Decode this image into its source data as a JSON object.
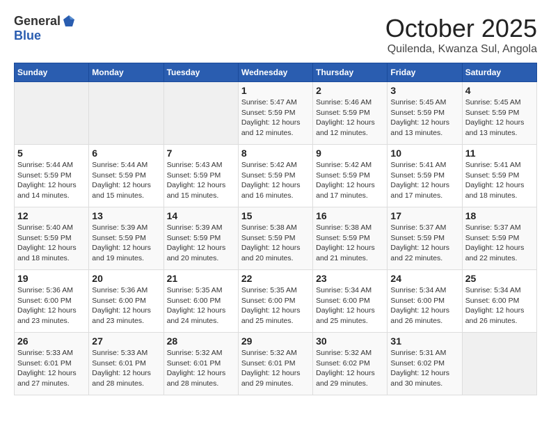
{
  "header": {
    "logo_general": "General",
    "logo_blue": "Blue",
    "month_title": "October 2025",
    "subtitle": "Quilenda, Kwanza Sul, Angola"
  },
  "days_of_week": [
    "Sunday",
    "Monday",
    "Tuesday",
    "Wednesday",
    "Thursday",
    "Friday",
    "Saturday"
  ],
  "weeks": [
    [
      {
        "day": "",
        "content": ""
      },
      {
        "day": "",
        "content": ""
      },
      {
        "day": "",
        "content": ""
      },
      {
        "day": "1",
        "content": "Sunrise: 5:47 AM\nSunset: 5:59 PM\nDaylight: 12 hours\nand 12 minutes."
      },
      {
        "day": "2",
        "content": "Sunrise: 5:46 AM\nSunset: 5:59 PM\nDaylight: 12 hours\nand 12 minutes."
      },
      {
        "day": "3",
        "content": "Sunrise: 5:45 AM\nSunset: 5:59 PM\nDaylight: 12 hours\nand 13 minutes."
      },
      {
        "day": "4",
        "content": "Sunrise: 5:45 AM\nSunset: 5:59 PM\nDaylight: 12 hours\nand 13 minutes."
      }
    ],
    [
      {
        "day": "5",
        "content": "Sunrise: 5:44 AM\nSunset: 5:59 PM\nDaylight: 12 hours\nand 14 minutes."
      },
      {
        "day": "6",
        "content": "Sunrise: 5:44 AM\nSunset: 5:59 PM\nDaylight: 12 hours\nand 15 minutes."
      },
      {
        "day": "7",
        "content": "Sunrise: 5:43 AM\nSunset: 5:59 PM\nDaylight: 12 hours\nand 15 minutes."
      },
      {
        "day": "8",
        "content": "Sunrise: 5:42 AM\nSunset: 5:59 PM\nDaylight: 12 hours\nand 16 minutes."
      },
      {
        "day": "9",
        "content": "Sunrise: 5:42 AM\nSunset: 5:59 PM\nDaylight: 12 hours\nand 17 minutes."
      },
      {
        "day": "10",
        "content": "Sunrise: 5:41 AM\nSunset: 5:59 PM\nDaylight: 12 hours\nand 17 minutes."
      },
      {
        "day": "11",
        "content": "Sunrise: 5:41 AM\nSunset: 5:59 PM\nDaylight: 12 hours\nand 18 minutes."
      }
    ],
    [
      {
        "day": "12",
        "content": "Sunrise: 5:40 AM\nSunset: 5:59 PM\nDaylight: 12 hours\nand 18 minutes."
      },
      {
        "day": "13",
        "content": "Sunrise: 5:39 AM\nSunset: 5:59 PM\nDaylight: 12 hours\nand 19 minutes."
      },
      {
        "day": "14",
        "content": "Sunrise: 5:39 AM\nSunset: 5:59 PM\nDaylight: 12 hours\nand 20 minutes."
      },
      {
        "day": "15",
        "content": "Sunrise: 5:38 AM\nSunset: 5:59 PM\nDaylight: 12 hours\nand 20 minutes."
      },
      {
        "day": "16",
        "content": "Sunrise: 5:38 AM\nSunset: 5:59 PM\nDaylight: 12 hours\nand 21 minutes."
      },
      {
        "day": "17",
        "content": "Sunrise: 5:37 AM\nSunset: 5:59 PM\nDaylight: 12 hours\nand 22 minutes."
      },
      {
        "day": "18",
        "content": "Sunrise: 5:37 AM\nSunset: 5:59 PM\nDaylight: 12 hours\nand 22 minutes."
      }
    ],
    [
      {
        "day": "19",
        "content": "Sunrise: 5:36 AM\nSunset: 6:00 PM\nDaylight: 12 hours\nand 23 minutes."
      },
      {
        "day": "20",
        "content": "Sunrise: 5:36 AM\nSunset: 6:00 PM\nDaylight: 12 hours\nand 23 minutes."
      },
      {
        "day": "21",
        "content": "Sunrise: 5:35 AM\nSunset: 6:00 PM\nDaylight: 12 hours\nand 24 minutes."
      },
      {
        "day": "22",
        "content": "Sunrise: 5:35 AM\nSunset: 6:00 PM\nDaylight: 12 hours\nand 25 minutes."
      },
      {
        "day": "23",
        "content": "Sunrise: 5:34 AM\nSunset: 6:00 PM\nDaylight: 12 hours\nand 25 minutes."
      },
      {
        "day": "24",
        "content": "Sunrise: 5:34 AM\nSunset: 6:00 PM\nDaylight: 12 hours\nand 26 minutes."
      },
      {
        "day": "25",
        "content": "Sunrise: 5:34 AM\nSunset: 6:00 PM\nDaylight: 12 hours\nand 26 minutes."
      }
    ],
    [
      {
        "day": "26",
        "content": "Sunrise: 5:33 AM\nSunset: 6:01 PM\nDaylight: 12 hours\nand 27 minutes."
      },
      {
        "day": "27",
        "content": "Sunrise: 5:33 AM\nSunset: 6:01 PM\nDaylight: 12 hours\nand 28 minutes."
      },
      {
        "day": "28",
        "content": "Sunrise: 5:32 AM\nSunset: 6:01 PM\nDaylight: 12 hours\nand 28 minutes."
      },
      {
        "day": "29",
        "content": "Sunrise: 5:32 AM\nSunset: 6:01 PM\nDaylight: 12 hours\nand 29 minutes."
      },
      {
        "day": "30",
        "content": "Sunrise: 5:32 AM\nSunset: 6:02 PM\nDaylight: 12 hours\nand 29 minutes."
      },
      {
        "day": "31",
        "content": "Sunrise: 5:31 AM\nSunset: 6:02 PM\nDaylight: 12 hours\nand 30 minutes."
      },
      {
        "day": "",
        "content": ""
      }
    ]
  ]
}
